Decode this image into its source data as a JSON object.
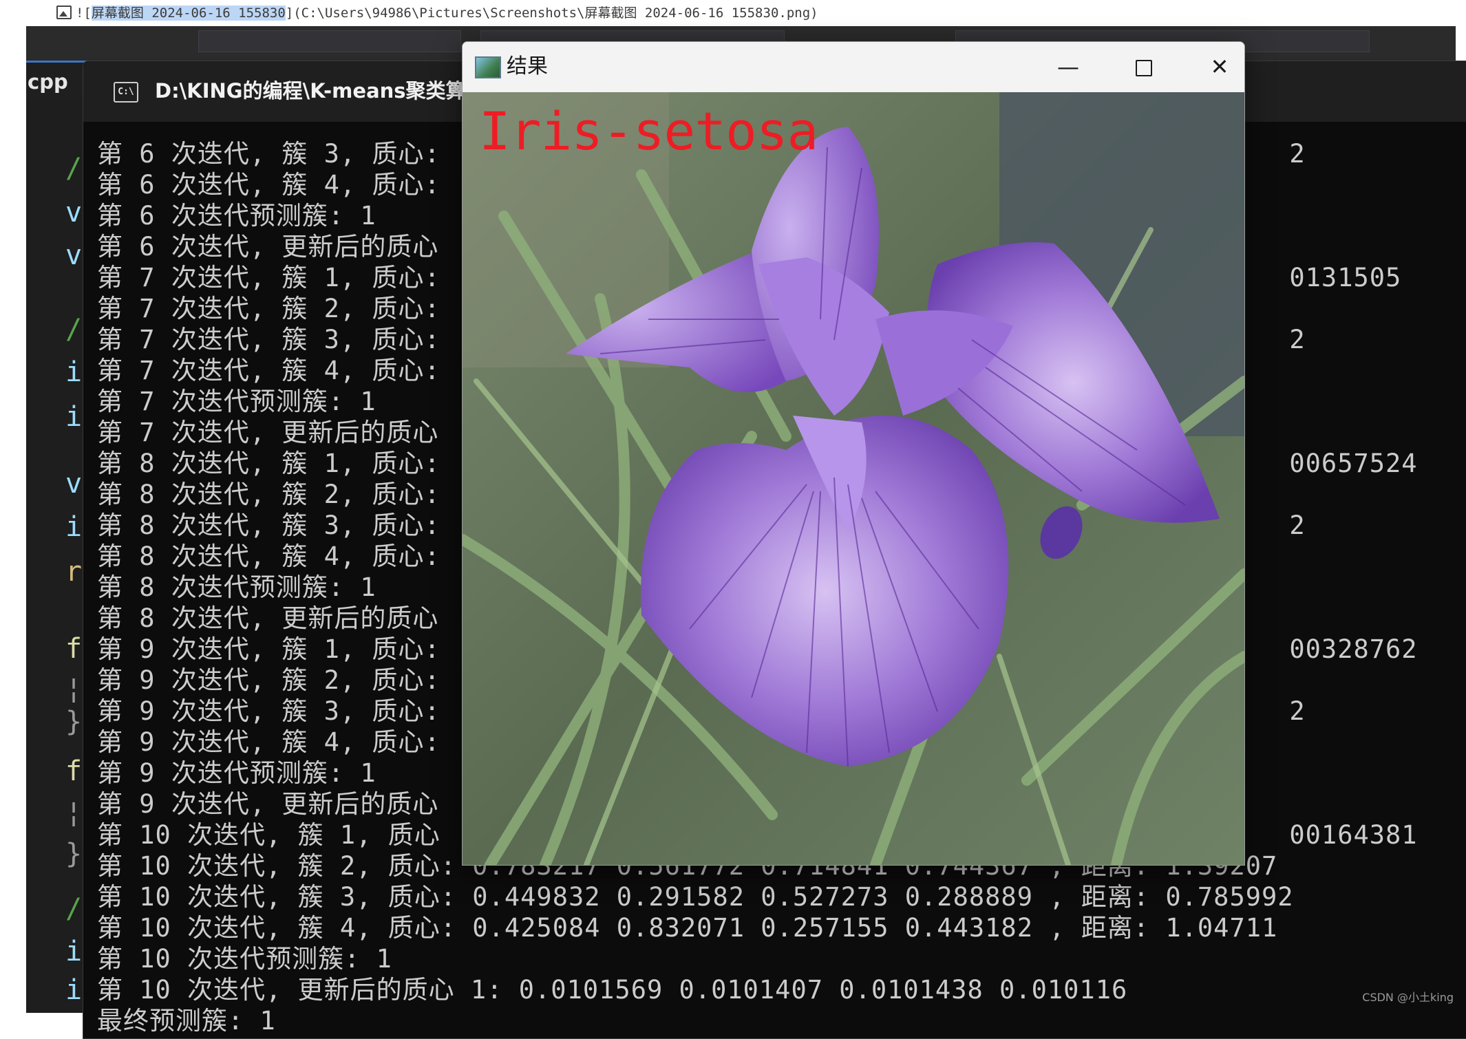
{
  "markdown_line": {
    "prefix": "![",
    "highlighted": "屏幕截图 2024-06-16 155830",
    "suffix": "](C:\\Users\\94986\\Pictures\\Screenshots\\屏幕截图 2024-06-16 155830.png)"
  },
  "ide": {
    "tab_label": "cpp",
    "gutter_chars": [
      "/",
      "v",
      "v",
      "/",
      "i",
      "i",
      "v",
      "i",
      "r",
      "f",
      "¦",
      "}",
      "f",
      "¦",
      "}",
      "/",
      "i",
      "i"
    ]
  },
  "console": {
    "title": "D:\\KING的编程\\K-means聚类算",
    "close_glyph": "✕",
    "icon_text": "C:\\",
    "lines": [
      "第 6 次迭代, 簇 3, 质心:                                                     2",
      "第 6 次迭代, 簇 4, 质心:",
      "第 6 次迭代预测簇: 1",
      "第 6 次迭代, 更新后的质心",
      "第 7 次迭代, 簇 1, 质心:                                                     0131505",
      "第 7 次迭代, 簇 2, 质心:",
      "第 7 次迭代, 簇 3, 质心:                                                     2",
      "第 7 次迭代, 簇 4, 质心:",
      "第 7 次迭代预测簇: 1",
      "第 7 次迭代, 更新后的质心",
      "第 8 次迭代, 簇 1, 质心:                                                     00657524",
      "第 8 次迭代, 簇 2, 质心:",
      "第 8 次迭代, 簇 3, 质心:                                                     2",
      "第 8 次迭代, 簇 4, 质心:",
      "第 8 次迭代预测簇: 1",
      "第 8 次迭代, 更新后的质心",
      "第 9 次迭代, 簇 1, 质心:                                                     00328762",
      "第 9 次迭代, 簇 2, 质心:",
      "第 9 次迭代, 簇 3, 质心:                                                     2",
      "第 9 次迭代, 簇 4, 质心:",
      "第 9 次迭代预测簇: 1",
      "第 9 次迭代, 更新后的质心",
      "第 10 次迭代, 簇 1, 质心                                                     00164381",
      "第 10 次迭代, 簇 2, 质心: 0.783217 0.561772 0.714841 0.744367 , 距离: 1.39207",
      "第 10 次迭代, 簇 3, 质心: 0.449832 0.291582 0.527273 0.288889 , 距离: 0.785992",
      "第 10 次迭代, 簇 4, 质心: 0.425084 0.832071 0.257155 0.443182 , 距离: 1.04711",
      "第 10 次迭代预测簇: 1",
      "第 10 次迭代, 更新后的质心 1: 0.0101569 0.0101407 0.0101438 0.010116",
      "最终预测簇: 1"
    ]
  },
  "result_window": {
    "title": "结果",
    "minimize_glyph": "—",
    "close_glyph": "✕",
    "overlay_label": "Iris-setosa",
    "label_color": "#ee1c24"
  },
  "watermark": "CSDN @小土king"
}
